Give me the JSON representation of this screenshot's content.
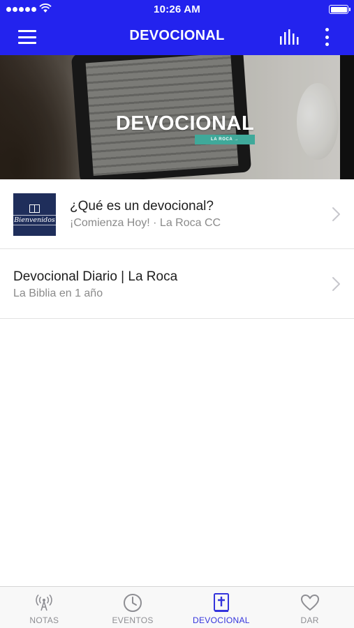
{
  "status_bar": {
    "time": "10:26 AM"
  },
  "header": {
    "title": "DEVOCIONAL",
    "background_color": "#2323ee",
    "icons": [
      "hamburger-menu-icon",
      "audio-bars-icon",
      "more-vertical-icon"
    ]
  },
  "banner": {
    "title": "DEVOCIONAL",
    "tag": "LA ROCA →",
    "tag_color": "#3fa99a"
  },
  "list": {
    "items": [
      {
        "title": "¿Qué es un devocional?",
        "subtitle": "¡Comienza Hoy! · La Roca CC",
        "thumbnail_text": "Bienvenidos",
        "thumbnail_color": "#1f2e5b"
      },
      {
        "title": "Devocional Diario | La Roca",
        "subtitle": "La Biblia en 1 año"
      }
    ]
  },
  "tabbar": {
    "active_color": "#3434dc",
    "inactive_color": "#8e8e93",
    "tabs": [
      {
        "label": "NOTAS",
        "icon": "broadcast-tower-icon",
        "active": false
      },
      {
        "label": "EVENTOS",
        "icon": "clock-icon",
        "active": false
      },
      {
        "label": "DEVOCIONAL",
        "icon": "bible-cross-icon",
        "active": true
      },
      {
        "label": "DAR",
        "icon": "heart-icon",
        "active": false
      }
    ]
  }
}
